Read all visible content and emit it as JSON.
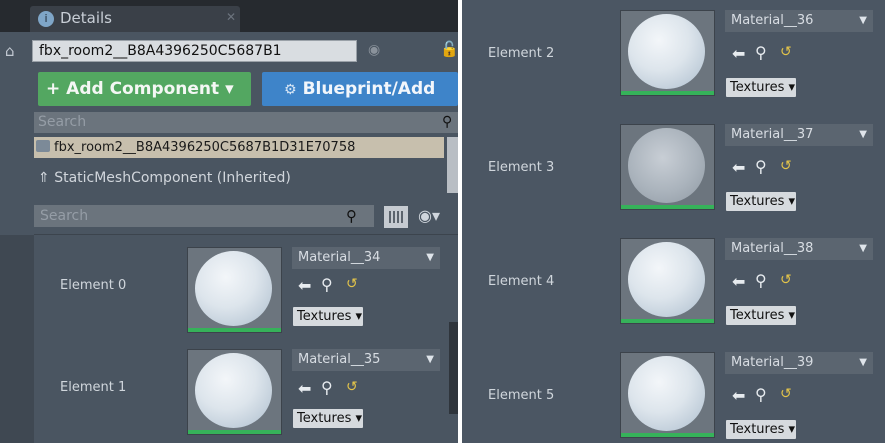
{
  "tab": {
    "label": "Details"
  },
  "actor": {
    "name": "fbx_room2__B8A4396250C5687B1"
  },
  "buttons": {
    "add_component": "+ Add Component ▾",
    "blueprint": "Blueprint/Add"
  },
  "search": {
    "placeholder_top": "Search",
    "placeholder_props": "Search"
  },
  "tree": {
    "root": "fbx_room2__B8A4396250C5687B1D31E70758",
    "child": "StaticMeshComponent (Inherited)"
  },
  "textures_label": "Textures ▾",
  "left_elements": [
    {
      "label": "Element 0",
      "material": "Material__34"
    },
    {
      "label": "Element 1",
      "material": "Material__35"
    }
  ],
  "right_elements": [
    {
      "label": "Element 2",
      "material": "Material__36"
    },
    {
      "label": "Element 3",
      "material": "Material__37"
    },
    {
      "label": "Element 4",
      "material": "Material__38"
    },
    {
      "label": "Element 5",
      "material": "Material__39"
    }
  ],
  "colors": {
    "accent_green": "#53a761",
    "accent_blue": "#3e84c9",
    "material_bar": "#36b25a"
  },
  "icons": [
    "home-icon",
    "lock-icon",
    "search-icon",
    "grid-icon",
    "eye-icon",
    "back-arrow-icon",
    "find-icon",
    "reset-icon"
  ]
}
